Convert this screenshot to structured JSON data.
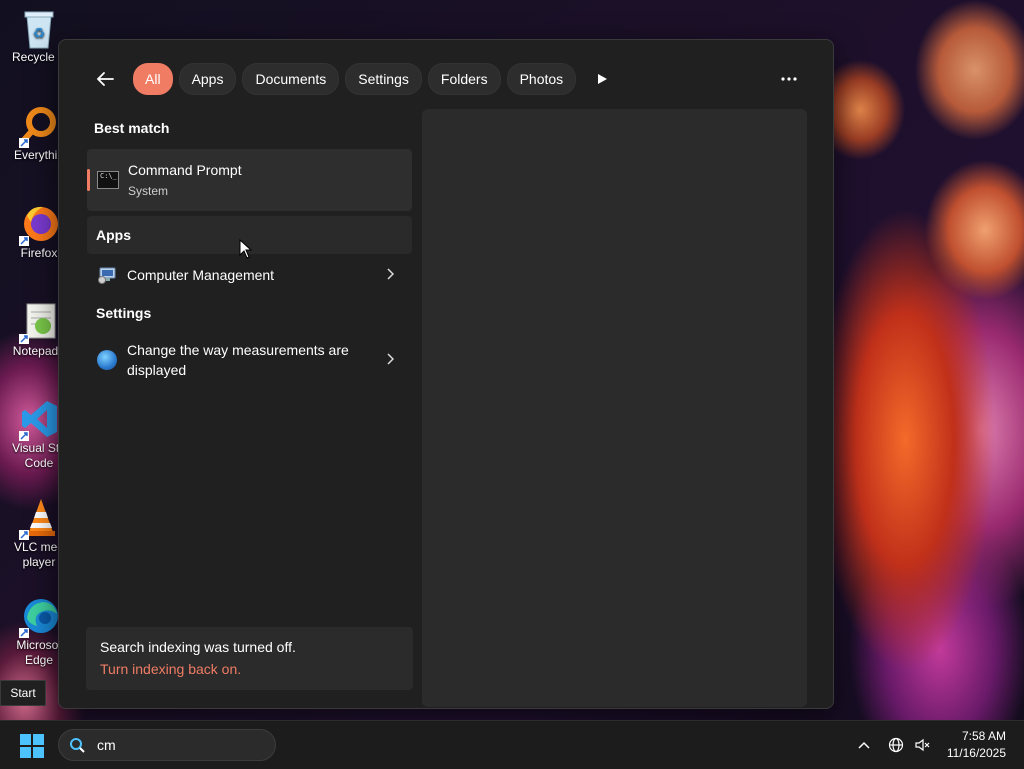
{
  "desktop": {
    "icons": [
      {
        "label": "Recycle B",
        "icon": "recycle-bin-icon"
      },
      {
        "label": "Everythin",
        "icon": "everything-search-icon"
      },
      {
        "label": "Firefox",
        "icon": "firefox-icon"
      },
      {
        "label": "Notepad+",
        "icon": "notepad-plus-plus-icon"
      },
      {
        "label": "Visual Stu Code",
        "icon": "vscode-icon"
      },
      {
        "label": "VLC med player",
        "icon": "vlc-icon"
      },
      {
        "label": "Microsof Edge",
        "icon": "edge-icon"
      }
    ]
  },
  "search_panel": {
    "filters": [
      "All",
      "Apps",
      "Documents",
      "Settings",
      "Folders",
      "Photos"
    ],
    "active_filter": "All",
    "best_match_header": "Best match",
    "best_match": {
      "title": "Command Prompt",
      "subtitle": "System"
    },
    "apps_header": "Apps",
    "apps": [
      {
        "title": "Computer Management"
      }
    ],
    "settings_header": "Settings",
    "settings": [
      {
        "title": "Change the way measurements are displayed"
      }
    ],
    "notice": {
      "message": "Search indexing was turned off.",
      "link": "Turn indexing back on."
    }
  },
  "start_tooltip": "Start",
  "taskbar": {
    "search_value": "cm",
    "time": "7:58 AM",
    "date": "11/16/2025"
  },
  "colors": {
    "accent": "#f07c64",
    "panel_bg": "#202020",
    "taskbar_bg": "#1c1c1c",
    "windows_blue": "#4cc2ff"
  }
}
